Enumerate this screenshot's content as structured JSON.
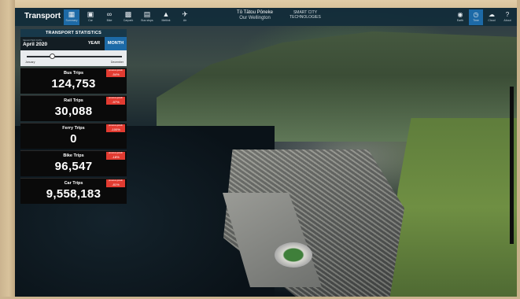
{
  "topbar": {
    "title": "Transport",
    "nav": [
      {
        "label": "Summary",
        "icon": "chart-icon",
        "active": true
      },
      {
        "label": "Car",
        "icon": "car-icon"
      },
      {
        "label": "Bike",
        "icon": "bike-icon"
      },
      {
        "label": "Carpark",
        "icon": "parking-icon"
      },
      {
        "label": "Bus stops",
        "icon": "bus-icon"
      },
      {
        "label": "Metlink",
        "icon": "train-icon"
      },
      {
        "label": "Air",
        "icon": "plane-icon"
      }
    ],
    "center_title": "Tō Tātou Pōneke",
    "center_subtitle": "Our Wellington",
    "smart_line1": "SMART CITY",
    "smart_line2": "TECHNOLOGIES",
    "right_nav": [
      {
        "label": "Earth",
        "icon": "globe-icon"
      },
      {
        "label": "Time",
        "icon": "clock-icon",
        "active": true
      },
      {
        "label": "Cloud",
        "icon": "cloud-icon"
      },
      {
        "label": "About",
        "icon": "question-icon"
      }
    ]
  },
  "panel": {
    "header": "TRANSPORT STATISTICS",
    "selected_caption": "SELECTED DATE",
    "selected_date": "April 2020",
    "year_label": "YEAR",
    "month_label": "MONTH",
    "slider_min": "January",
    "slider_max": "December",
    "stats": [
      {
        "name": "Bus Trips",
        "value": "124,753",
        "badge_label": "previous growth",
        "badge_value": "-54%"
      },
      {
        "name": "Rail Trips",
        "value": "30,088",
        "badge_label": "previous growth",
        "badge_value": "-97%"
      },
      {
        "name": "Ferry Trips",
        "value": "0",
        "badge_label": "previous growth",
        "badge_value": "-100%"
      },
      {
        "name": "Bike Trips",
        "value": "96,547",
        "badge_label": "previous growth",
        "badge_value": "-18%"
      },
      {
        "name": "Car Trips",
        "value": "9,558,183",
        "badge_label": "previous growth",
        "badge_value": "-81%"
      }
    ]
  },
  "colors": {
    "topbar": "#122c3a",
    "accent": "#1d6aa7",
    "badge": "#e23b31"
  }
}
